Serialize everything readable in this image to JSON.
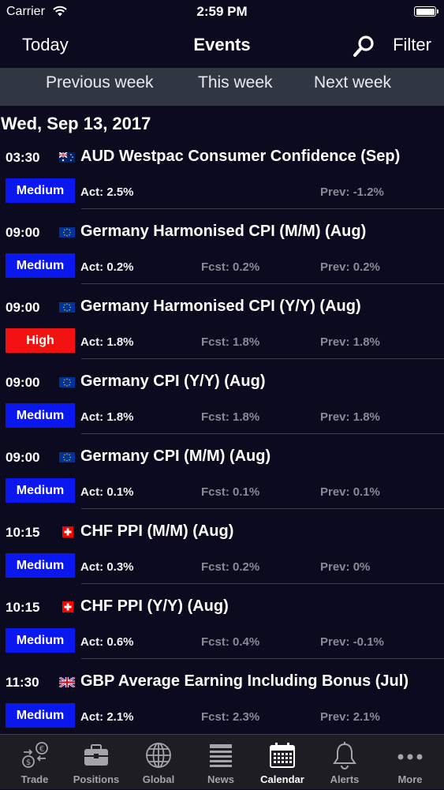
{
  "status_bar": {
    "carrier": "Carrier",
    "time": "2:59 PM"
  },
  "nav": {
    "left_label": "Today",
    "title": "Events",
    "filter_label": "Filter"
  },
  "week_tabs": [
    "Previous week",
    "This week",
    "Next week"
  ],
  "date_header": "Wed, Sep 13, 2017",
  "events": [
    {
      "time": "03:30",
      "flag": "au",
      "title": "AUD Westpac Consumer Confidence (Sep)",
      "impact": "Medium",
      "actual": "Act: 2.5%",
      "forecast": "",
      "previous": "Prev: -1.2%"
    },
    {
      "time": "09:00",
      "flag": "eu",
      "title": "Germany Harmonised CPI (M/M) (Aug)",
      "impact": "Medium",
      "actual": "Act: 0.2%",
      "forecast": "Fcst: 0.2%",
      "previous": "Prev: 0.2%"
    },
    {
      "time": "09:00",
      "flag": "eu",
      "title": "Germany Harmonised CPI (Y/Y) (Aug)",
      "impact": "High",
      "actual": "Act: 1.8%",
      "forecast": "Fcst: 1.8%",
      "previous": "Prev: 1.8%"
    },
    {
      "time": "09:00",
      "flag": "eu",
      "title": "Germany CPI (Y/Y) (Aug)",
      "impact": "Medium",
      "actual": "Act: 1.8%",
      "forecast": "Fcst: 1.8%",
      "previous": "Prev: 1.8%"
    },
    {
      "time": "09:00",
      "flag": "eu",
      "title": "Germany CPI (M/M) (Aug)",
      "impact": "Medium",
      "actual": "Act: 0.1%",
      "forecast": "Fcst: 0.1%",
      "previous": "Prev: 0.1%"
    },
    {
      "time": "10:15",
      "flag": "ch",
      "title": "CHF PPI (M/M) (Aug)",
      "impact": "Medium",
      "actual": "Act: 0.3%",
      "forecast": "Fcst: 0.2%",
      "previous": "Prev: 0%"
    },
    {
      "time": "10:15",
      "flag": "ch",
      "title": "CHF PPI (Y/Y) (Aug)",
      "impact": "Medium",
      "actual": "Act: 0.6%",
      "forecast": "Fcst: 0.4%",
      "previous": "Prev: -0.1%"
    },
    {
      "time": "11:30",
      "flag": "gb",
      "title": "GBP Average Earning Including Bonus (Jul)",
      "impact": "Medium",
      "actual": "Act: 2.1%",
      "forecast": "Fcst: 2.3%",
      "previous": "Prev: 2.1%"
    }
  ],
  "tabs": [
    {
      "label": "Trade",
      "icon": "trade-icon"
    },
    {
      "label": "Positions",
      "icon": "briefcase-icon"
    },
    {
      "label": "Global",
      "icon": "globe-icon"
    },
    {
      "label": "News",
      "icon": "news-icon"
    },
    {
      "label": "Calendar",
      "icon": "calendar-icon",
      "active": true
    },
    {
      "label": "Alerts",
      "icon": "bell-icon"
    },
    {
      "label": "More",
      "icon": "more-icon"
    }
  ],
  "colors": {
    "background": "#0b0a1e",
    "week_bar": "#303743",
    "medium": "#0b17ef",
    "high": "#f21212",
    "tab_bar": "#1d1d23"
  }
}
